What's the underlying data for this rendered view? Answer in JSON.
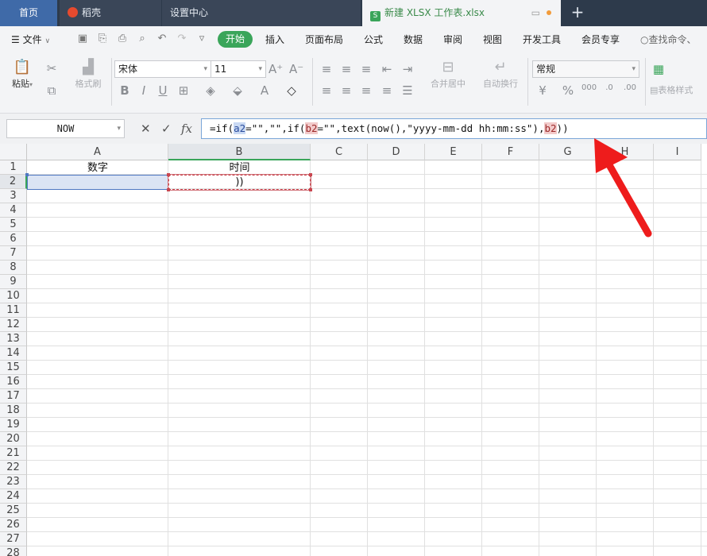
{
  "tabs": {
    "home": "首页",
    "daoke": "稻壳",
    "settings": "设置中心",
    "active": "新建 XLSX 工作表.xlsx",
    "new_tab": "+"
  },
  "menu": {
    "file": "文件",
    "start": "开始",
    "items": [
      "插入",
      "页面布局",
      "公式",
      "数据",
      "审阅",
      "视图",
      "开发工具",
      "会员专享"
    ],
    "search": "查找命令、"
  },
  "ribbon": {
    "paste": "粘贴",
    "format_painter": "格式刷",
    "font_name": "宋体",
    "font_size": "11",
    "merge_center": "合并居中",
    "wrap_text": "自动换行",
    "number_format": "常规",
    "table_style": "表格样式"
  },
  "formula_bar": {
    "name_box": "NOW",
    "fx": "fx",
    "formula_parts": [
      "=if(",
      "a2",
      "=\"\",\"\",if(",
      "b2",
      "=\"\",text(now(),\"yyyy-mm-dd hh:mm:ss\"),",
      "b2",
      "))"
    ]
  },
  "sheet": {
    "columns": [
      "A",
      "B",
      "C",
      "D",
      "E",
      "F",
      "G",
      "H",
      "I"
    ],
    "rows": [
      "1",
      "2",
      "3",
      "4",
      "5",
      "6",
      "7",
      "8",
      "9",
      "10",
      "11",
      "12",
      "13",
      "14",
      "15",
      "16",
      "17",
      "18",
      "19",
      "20",
      "21",
      "22",
      "23",
      "24",
      "25",
      "26",
      "27",
      "28"
    ],
    "cells": {
      "A1": "数字",
      "B1": "时间",
      "B2": "))"
    }
  },
  "colors": {
    "accent_green": "#3aa55a",
    "tab_bar": "#2d3a4b",
    "arrow_red": "#ee1c1c"
  }
}
